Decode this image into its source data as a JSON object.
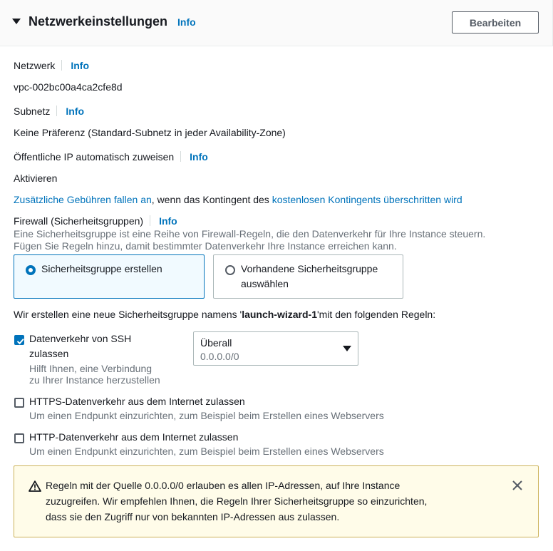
{
  "header": {
    "title": "Netzwerkeinstellungen",
    "info": "Info",
    "edit_button": "Bearbeiten"
  },
  "network": {
    "label": "Netzwerk",
    "info": "Info",
    "value": "vpc-002bc00a4ca2cfe8d"
  },
  "subnet": {
    "label": "Subnetz",
    "info": "Info",
    "value": "Keine Präferenz (Standard-Subnetz in jeder Availability-Zone)"
  },
  "public_ip": {
    "label": "Öffentliche IP automatisch zuweisen",
    "info": "Info",
    "value": "Aktivieren"
  },
  "charges": {
    "link1": "Zusätzliche Gebühren fallen an",
    "text": ", wenn das Kontingent des ",
    "link2": "kostenlosen Kontingents überschritten wird"
  },
  "firewall": {
    "label": "Firewall (Sicherheitsgruppen)",
    "info": "Info",
    "description_line1": "Eine Sicherheitsgruppe ist eine Reihe von Firewall-Regeln, die den Datenverkehr für Ihre Instance steuern.",
    "description_line2": "Fügen Sie Regeln hinzu, damit bestimmter Datenverkehr Ihre Instance erreichen kann.",
    "option_create": "Sicherheitsgruppe erstellen",
    "option_existing_line1": "Vorhandene Sicherheitsgruppe",
    "option_existing_line2": "auswählen",
    "selected_option": "create"
  },
  "rules_intro": {
    "prefix": "Wir erstellen eine neue Sicherheitsgruppe namens '",
    "name": "launch-wizard-1",
    "suffix": "'mit den folgenden Regeln:"
  },
  "rules": {
    "ssh": {
      "label_line1": "Datenverkehr von SSH",
      "label_line2": "zulassen",
      "desc_line1": "Hilft Ihnen, eine Verbindung",
      "desc_line2": "zu Ihrer Instance herzustellen",
      "checked": true
    },
    "ssh_source": {
      "selected": "Überall",
      "cidr": "0.0.0.0/0"
    },
    "https": {
      "label": "HTTPS-Datenverkehr aus dem Internet zulassen",
      "desc": "Um einen Endpunkt einzurichten, zum Beispiel beim Erstellen eines Webservers",
      "checked": false
    },
    "http": {
      "label": "HTTP-Datenverkehr aus dem Internet zulassen",
      "desc": "Um einen Endpunkt einzurichten, zum Beispiel beim Erstellen eines Webservers",
      "checked": false
    }
  },
  "warning": {
    "line1": "Regeln mit der Quelle 0.0.0.0/0 erlauben es allen IP-Adressen, auf Ihre Instance",
    "line2": "zuzugreifen. Wir empfehlen Ihnen, die Regeln Ihrer Sicherheitsgruppe so einzurichten,",
    "line3": "dass sie den Zugriff nur von bekannten IP-Adressen aus zulassen.",
    "icon": "warning-icon"
  },
  "colors": {
    "link": "#0073bb",
    "selected_tile_bg": "#f1faff",
    "warning_bg": "#fffce9",
    "warning_border": "#ccb25a"
  }
}
